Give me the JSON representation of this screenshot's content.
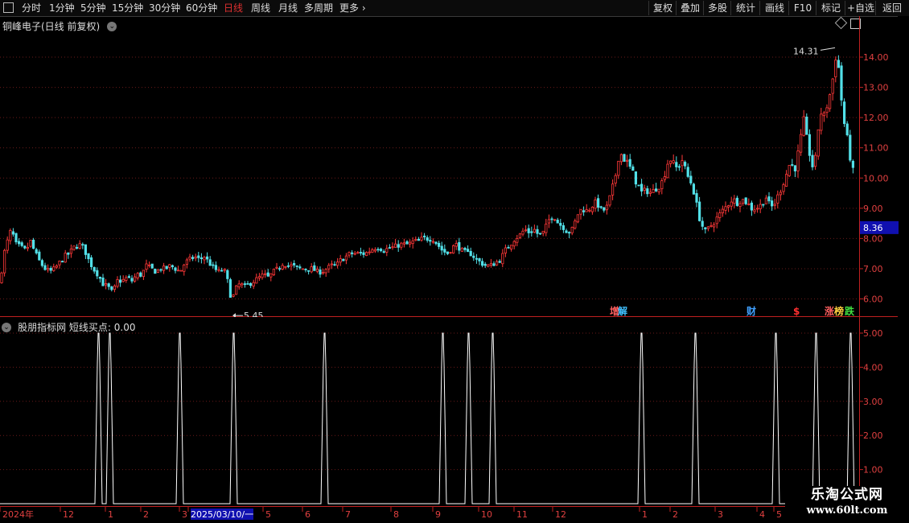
{
  "toolbar": {
    "left_items": [
      "分时",
      "1分钟",
      "5分钟",
      "15分钟",
      "30分钟",
      "60分钟",
      "日线",
      "周线",
      "月线",
      "多周期",
      "更多"
    ],
    "active": "日线",
    "right_items": [
      "复权",
      "叠加",
      "多股",
      "统计",
      "画线",
      "F10",
      "标记",
      "+自选",
      "返回"
    ]
  },
  "main_chart": {
    "title": "铜峰电子(日线 前复权)",
    "current_price_label": "8.36",
    "high_label": "14.31",
    "low_label": "5.45",
    "event_tags": [
      {
        "text": "增",
        "color": "#ff6060"
      },
      {
        "text": "解",
        "color": "#40c0ff"
      },
      {
        "text": "财",
        "color": "#40a0ff"
      },
      {
        "text": "$",
        "color": "#ff3030"
      },
      {
        "text": "涨",
        "color": "#ff6060"
      },
      {
        "text": "榜",
        "color": "#ffd040"
      },
      {
        "text": "跌",
        "color": "#40e040"
      }
    ]
  },
  "indicator": {
    "title": "股朋指标网  短线买点: 0.00",
    "y_ticks": [
      "5.00",
      "4.00",
      "3.00",
      "2.00",
      "1.00"
    ]
  },
  "time_axis": {
    "labels": [
      "2024年",
      "12",
      "1",
      "2",
      "3",
      "2025/03/10/一",
      "5",
      "6",
      "7",
      "8",
      "9",
      "10",
      "11",
      "12",
      "1",
      "2",
      "3",
      "4",
      "5"
    ]
  },
  "watermark": {
    "line1": "乐淘公式网",
    "line2": "www.60lt.com"
  },
  "chart_data": [
    {
      "type": "candlestick",
      "title": "铜峰电子(日线 前复权)",
      "ylim": [
        5.2,
        14.6
      ],
      "y_ticks": [
        6.0,
        7.0,
        8.0,
        9.0,
        10.0,
        11.0,
        12.0,
        13.0,
        14.0
      ],
      "x_ticks": [
        "2024年",
        "12",
        "1",
        "2",
        "3",
        "2025/03/10/一",
        "5",
        "6",
        "7",
        "8",
        "9",
        "10",
        "11",
        "12",
        "1",
        "2",
        "3",
        "4",
        "5"
      ],
      "close_path": [
        [
          0,
          6.5
        ],
        [
          4,
          7.4
        ],
        [
          8,
          7.8
        ],
        [
          14,
          8.3
        ],
        [
          20,
          7.8
        ],
        [
          26,
          7.7
        ],
        [
          32,
          7.6
        ],
        [
          38,
          7.9
        ],
        [
          44,
          7.5
        ],
        [
          50,
          7.2
        ],
        [
          56,
          7.0
        ],
        [
          62,
          6.9
        ],
        [
          68,
          7.0
        ],
        [
          74,
          7.2
        ],
        [
          80,
          7.4
        ],
        [
          86,
          7.5
        ],
        [
          92,
          7.7
        ],
        [
          98,
          7.8
        ],
        [
          104,
          7.7
        ],
        [
          110,
          7.3
        ],
        [
          116,
          7.0
        ],
        [
          122,
          6.8
        ],
        [
          128,
          6.5
        ],
        [
          134,
          6.4
        ],
        [
          140,
          6.2
        ],
        [
          146,
          6.6
        ],
        [
          152,
          6.6
        ],
        [
          158,
          6.7
        ],
        [
          164,
          6.6
        ],
        [
          170,
          6.8
        ],
        [
          176,
          6.8
        ],
        [
          182,
          7.1
        ],
        [
          188,
          7.0
        ],
        [
          194,
          6.9
        ],
        [
          200,
          7.0
        ],
        [
          206,
          7.0
        ],
        [
          212,
          7.1
        ],
        [
          218,
          7.0
        ],
        [
          224,
          6.9
        ],
        [
          230,
          7.2
        ],
        [
          236,
          7.3
        ],
        [
          242,
          7.4
        ],
        [
          248,
          7.3
        ],
        [
          254,
          7.4
        ],
        [
          260,
          7.2
        ],
        [
          266,
          7.0
        ],
        [
          272,
          6.9
        ],
        [
          278,
          7.0
        ],
        [
          284,
          6.5
        ],
        [
          288,
          5.9
        ],
        [
          292,
          6.3
        ],
        [
          298,
          6.5
        ],
        [
          304,
          6.4
        ],
        [
          310,
          6.5
        ],
        [
          316,
          6.6
        ],
        [
          322,
          6.7
        ],
        [
          328,
          6.8
        ],
        [
          334,
          6.7
        ],
        [
          340,
          6.9
        ],
        [
          346,
          7.0
        ],
        [
          352,
          7.2
        ],
        [
          358,
          7.1
        ],
        [
          364,
          7.1
        ],
        [
          370,
          7.0
        ],
        [
          376,
          7.0
        ],
        [
          382,
          7.0
        ],
        [
          388,
          7.0
        ],
        [
          394,
          6.9
        ],
        [
          400,
          6.9
        ],
        [
          406,
          7.0
        ],
        [
          412,
          7.1
        ],
        [
          418,
          7.1
        ],
        [
          424,
          7.3
        ],
        [
          430,
          7.4
        ],
        [
          436,
          7.5
        ],
        [
          442,
          7.5
        ],
        [
          448,
          7.5
        ],
        [
          454,
          7.5
        ],
        [
          460,
          7.6
        ],
        [
          466,
          7.7
        ],
        [
          472,
          7.7
        ],
        [
          478,
          7.6
        ],
        [
          484,
          7.7
        ],
        [
          490,
          7.7
        ],
        [
          496,
          7.8
        ],
        [
          502,
          7.8
        ],
        [
          508,
          7.8
        ],
        [
          514,
          7.9
        ],
        [
          520,
          7.9
        ],
        [
          526,
          8.0
        ],
        [
          532,
          8.0
        ],
        [
          538,
          8.0
        ],
        [
          544,
          7.8
        ],
        [
          550,
          7.6
        ],
        [
          556,
          7.5
        ],
        [
          562,
          7.7
        ],
        [
          568,
          7.8
        ],
        [
          574,
          7.6
        ],
        [
          580,
          7.5
        ],
        [
          586,
          7.5
        ],
        [
          592,
          7.3
        ],
        [
          598,
          7.2
        ],
        [
          604,
          7.1
        ],
        [
          610,
          7.1
        ],
        [
          616,
          7.2
        ],
        [
          622,
          7.3
        ],
        [
          628,
          7.6
        ],
        [
          634,
          7.8
        ],
        [
          640,
          8.0
        ],
        [
          646,
          8.1
        ],
        [
          652,
          8.3
        ],
        [
          658,
          8.2
        ],
        [
          664,
          8.3
        ],
        [
          670,
          8.1
        ],
        [
          676,
          8.2
        ],
        [
          682,
          8.6
        ],
        [
          688,
          8.8
        ],
        [
          694,
          8.5
        ],
        [
          700,
          8.4
        ],
        [
          706,
          8.2
        ],
        [
          712,
          8.3
        ],
        [
          718,
          8.8
        ],
        [
          724,
          9.0
        ],
        [
          730,
          8.9
        ],
        [
          736,
          9.1
        ],
        [
          742,
          9.2
        ],
        [
          748,
          8.9
        ],
        [
          754,
          9.0
        ],
        [
          760,
          9.5
        ],
        [
          766,
          10.2
        ],
        [
          770,
          10.9
        ],
        [
          774,
          10.7
        ],
        [
          780,
          10.5
        ],
        [
          786,
          10.2
        ],
        [
          792,
          9.8
        ],
        [
          798,
          9.5
        ],
        [
          804,
          9.6
        ],
        [
          810,
          9.5
        ],
        [
          816,
          9.7
        ],
        [
          822,
          9.8
        ],
        [
          828,
          10.3
        ],
        [
          832,
          10.7
        ],
        [
          836,
          10.5
        ],
        [
          842,
          10.3
        ],
        [
          848,
          10.6
        ],
        [
          854,
          10.1
        ],
        [
          860,
          9.8
        ],
        [
          864,
          9.4
        ],
        [
          868,
          8.8
        ],
        [
          872,
          8.5
        ],
        [
          876,
          8.2
        ],
        [
          880,
          8.3
        ],
        [
          886,
          8.5
        ],
        [
          892,
          8.7
        ],
        [
          898,
          8.9
        ],
        [
          904,
          9.1
        ],
        [
          910,
          9.3
        ],
        [
          916,
          9.2
        ],
        [
          922,
          9.3
        ],
        [
          928,
          9.2
        ],
        [
          934,
          9.0
        ],
        [
          940,
          9.0
        ],
        [
          946,
          9.1
        ],
        [
          952,
          9.4
        ],
        [
          958,
          9.0
        ],
        [
          964,
          9.2
        ],
        [
          970,
          9.6
        ],
        [
          976,
          10.0
        ],
        [
          982,
          10.5
        ],
        [
          988,
          10.3
        ],
        [
          992,
          10.8
        ],
        [
          996,
          11.4
        ],
        [
          1000,
          12.0
        ],
        [
          1004,
          11.0
        ],
        [
          1008,
          10.7
        ],
        [
          1012,
          10.1
        ],
        [
          1016,
          11.4
        ],
        [
          1020,
          12.2
        ],
        [
          1024,
          12.0
        ],
        [
          1028,
          12.4
        ],
        [
          1032,
          12.8
        ],
        [
          1036,
          13.4
        ],
        [
          1040,
          14.3
        ],
        [
          1044,
          13.2
        ],
        [
          1048,
          12.0
        ],
        [
          1052,
          11.5
        ],
        [
          1056,
          10.8
        ],
        [
          1060,
          10.3
        ],
        [
          1063,
          9.7
        ]
      ],
      "current_price": 8.36,
      "max_label": 14.31,
      "min_label": 5.45
    },
    {
      "type": "line",
      "title": "股朋指标网  短线买点: 0.00",
      "ylim": [
        0,
        5.3
      ],
      "y_ticks": [
        5.0,
        4.0,
        3.0,
        2.0,
        1.0
      ],
      "series": [
        {
          "values_signal_days": [
            123,
            137,
            224,
            291,
            404,
            551,
            583,
            613,
            798,
            865,
            965,
            1015,
            1058
          ],
          "peak": 5.0
        }
      ]
    }
  ]
}
